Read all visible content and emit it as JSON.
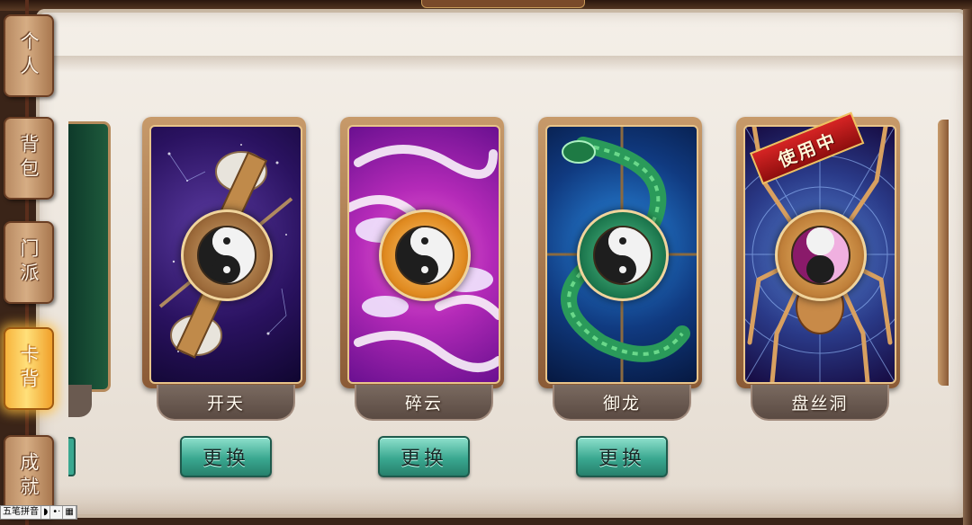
{
  "sidebar": {
    "tabs": [
      {
        "label": "个人",
        "active": false
      },
      {
        "label": "背包",
        "active": false
      },
      {
        "label": "门派",
        "active": false
      },
      {
        "label": "卡背",
        "active": true
      },
      {
        "label": "成就",
        "active": false
      }
    ]
  },
  "cards": [
    {
      "name": "开天",
      "button": "更换",
      "theme": "cosmic-axes"
    },
    {
      "name": "碎云",
      "button": "更换",
      "theme": "purple-clouds"
    },
    {
      "name": "御龙",
      "button": "更换",
      "theme": "jade-dragon"
    },
    {
      "name": "盘丝洞",
      "badge": "使用中",
      "theme": "golden-spider"
    }
  ],
  "ime": {
    "mode": "五笔拼音"
  },
  "colors": {
    "panel": "#ece5dc",
    "active_tab": "#ffd15a",
    "button": "#3aa890",
    "badge": "#c41a1a",
    "name_plate": "#6a5a50"
  }
}
